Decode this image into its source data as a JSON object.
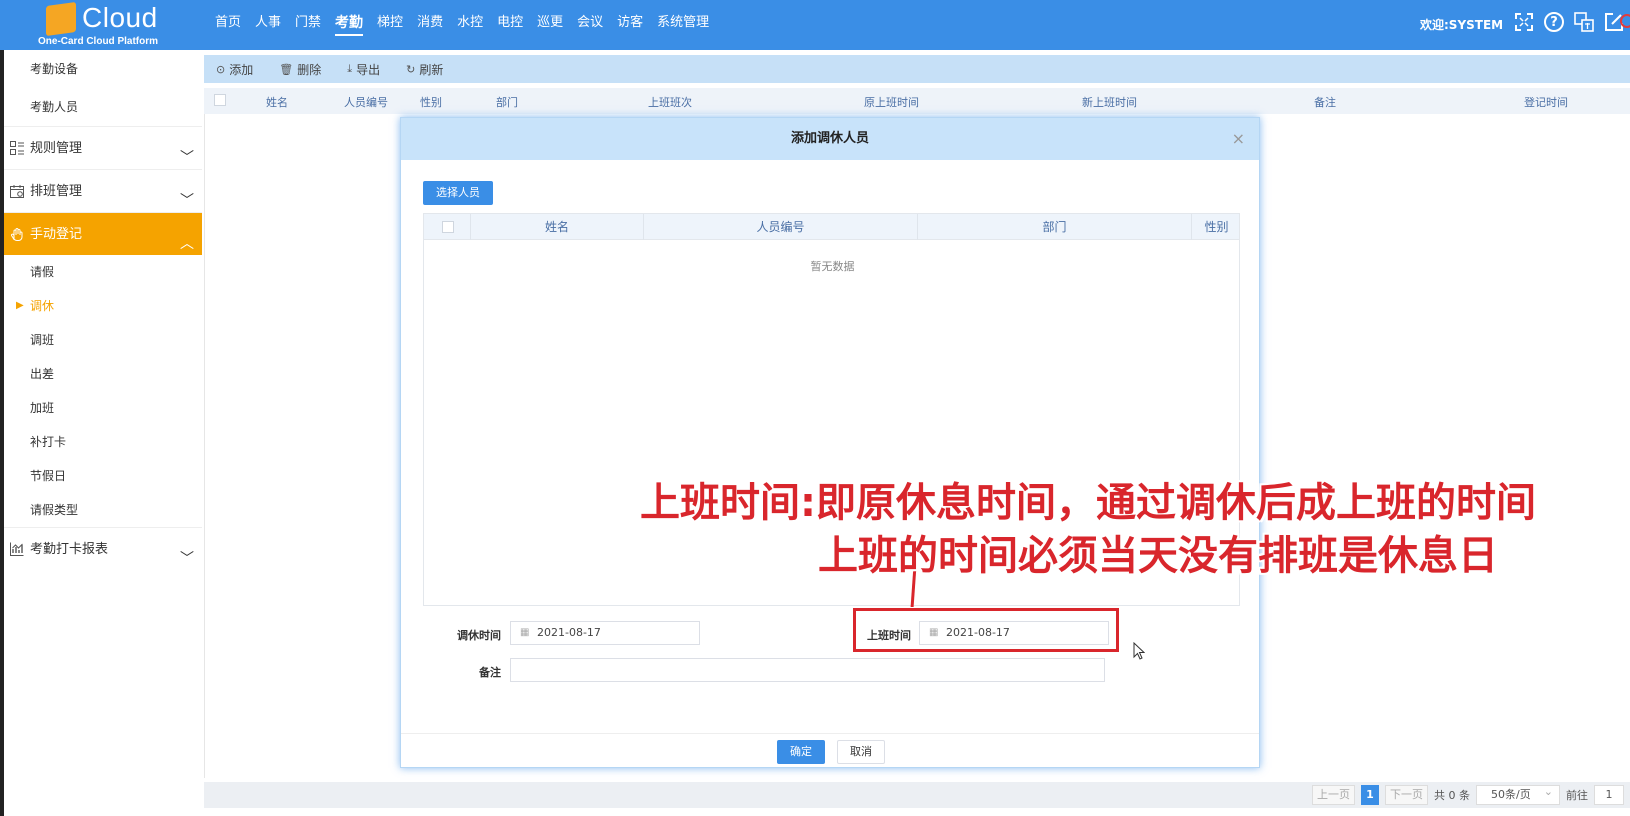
{
  "brand": {
    "name": "Cloud",
    "subtitle": "One-Card Cloud Platform",
    "accent": "#3a8ee6",
    "logo_color": "#f5a623"
  },
  "nav": {
    "items": [
      "首页",
      "人事",
      "门禁",
      "考勤",
      "梯控",
      "消费",
      "水控",
      "电控",
      "巡更",
      "会议",
      "访客",
      "系统管理"
    ],
    "active": "考勤",
    "welcome": "欢迎:SYSTEM",
    "icons": [
      "fullscreen-icon",
      "help-icon",
      "language-icon",
      "edit-icon",
      "power-icon"
    ]
  },
  "sidebar": {
    "top_items": [
      "考勤设备",
      "考勤人员"
    ],
    "groups": [
      {
        "label": "规则管理",
        "icon": "list-icon"
      },
      {
        "label": "排班管理",
        "icon": "calendar-icon"
      },
      {
        "label": "手动登记",
        "icon": "hand-icon",
        "active": true
      },
      {
        "label": "考勤打卡报表",
        "icon": "chart-icon"
      }
    ],
    "manual_items": [
      "请假",
      "调休",
      "调班",
      "出差",
      "加班",
      "补打卡",
      "节假日",
      "请假类型"
    ],
    "active_item": "调休",
    "active_color": "#f5a300"
  },
  "toolbar": {
    "add": "添加",
    "delete": "删除",
    "export": "导出",
    "refresh": "刷新"
  },
  "table": {
    "columns": [
      "姓名",
      "人员编号",
      "性别",
      "部门",
      "上班班次",
      "原上班时间",
      "新上班时间",
      "备注",
      "登记时间"
    ]
  },
  "pager": {
    "prev": "上一页",
    "current": "1",
    "next": "下一页",
    "total": "共 0 条",
    "page_size": "50条/页",
    "goto_label": "前往",
    "goto_value": "1"
  },
  "modal": {
    "title": "添加调休人员",
    "select_button": "选择人员",
    "columns": [
      "姓名",
      "人员编号",
      "部门",
      "性别"
    ],
    "empty_text": "暂无数据",
    "rest_time_label": "调休时间",
    "rest_time_value": "2021-08-17",
    "work_time_label": "上班时间",
    "work_time_value": "2021-08-17",
    "remark_label": "备注",
    "remark_value": "",
    "ok": "确定",
    "cancel": "取消"
  },
  "annotation": {
    "line1": "上班时间:即原休息时间，通过调休后成上班的时间",
    "line2": "上班的时间必须当天没有排班是休息日",
    "color": "#d9262c"
  }
}
